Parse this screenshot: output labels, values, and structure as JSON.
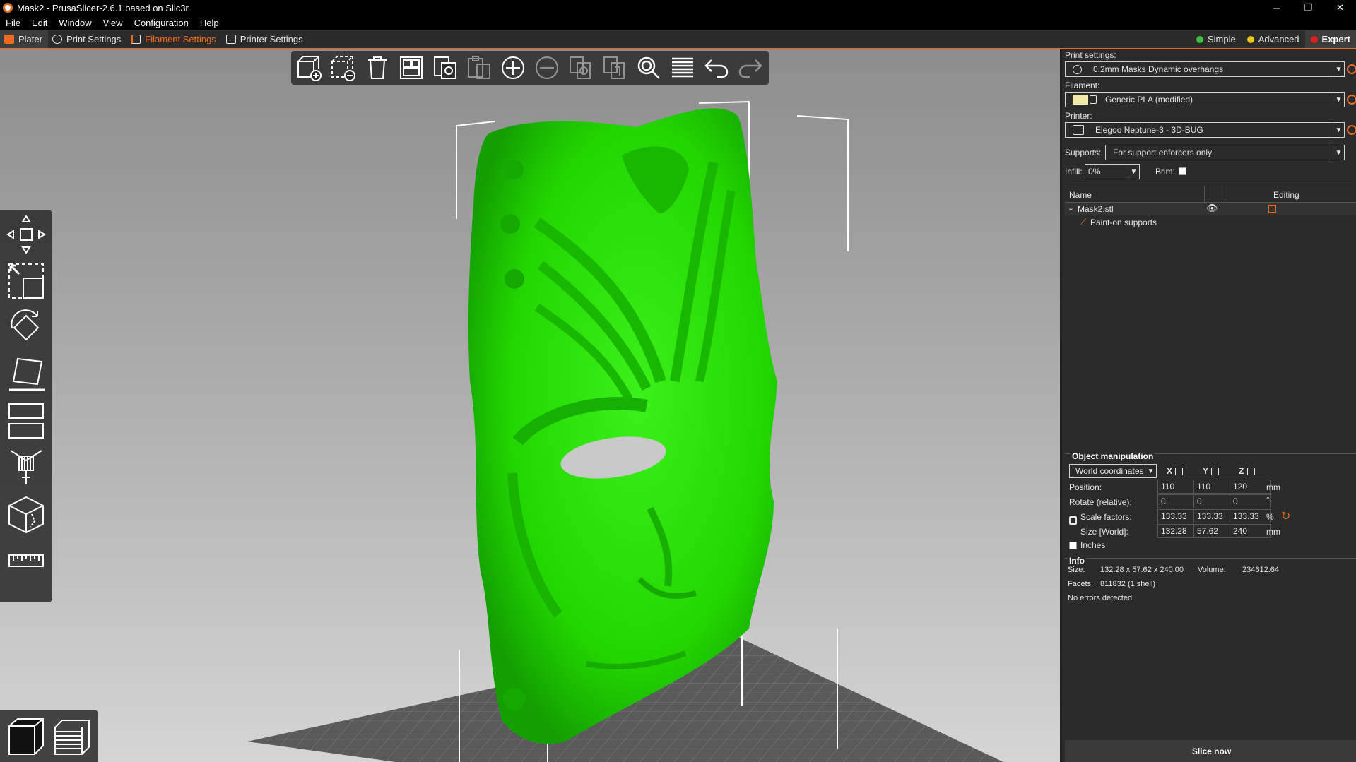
{
  "window": {
    "title": "Mask2 - PrusaSlicer-2.6.1 based on Slic3r",
    "controls": [
      "─",
      "❐",
      "✕"
    ]
  },
  "menu": [
    "File",
    "Edit",
    "Window",
    "View",
    "Configuration",
    "Help"
  ],
  "tabs": [
    {
      "label": "Plater",
      "icon": "plater-icon"
    },
    {
      "label": "Print Settings",
      "icon": "print-settings-icon"
    },
    {
      "label": "Filament Settings",
      "icon": "filament-icon"
    },
    {
      "label": "Printer Settings",
      "icon": "printer-icon"
    }
  ],
  "modes": [
    {
      "label": "Simple",
      "color": "#3ec13e"
    },
    {
      "label": "Advanced",
      "color": "#e8c51a"
    },
    {
      "label": "Expert",
      "color": "#e02020"
    }
  ],
  "toolbar_icons": [
    "add-icon",
    "delete-icon",
    "delete-all-icon",
    "arrange-icon",
    "copy-icon",
    "paste-icon",
    "add-instance-icon",
    "remove-instance-icon",
    "split-objects-icon",
    "split-parts-icon",
    "search-icon",
    "layers-editing-icon",
    "undo-icon",
    "redo-icon"
  ],
  "left_tools": [
    "move-icon",
    "scale-icon",
    "rotate-icon",
    "place-on-face-icon",
    "cut-icon",
    "support-paint-icon",
    "seam-paint-icon",
    "measure-icon"
  ],
  "view_toggle": [
    "3d-view-icon",
    "preview-icon"
  ],
  "sidebar": {
    "print_settings_label": "Print settings:",
    "print_settings_value": "0.2mm Masks Dynamic overhangs",
    "filament_label": "Filament:",
    "filament_value": "Generic PLA (modified)",
    "filament_color": "#f0e9a8",
    "printer_label": "Printer:",
    "printer_value": "Elegoo Neptune-3 - 3D-BUG",
    "supports_label": "Supports:",
    "supports_value": "For support enforcers only",
    "infill_label": "Infill:",
    "infill_value": "0%",
    "brim_label": "Brim:",
    "object_list": {
      "col_name": "Name",
      "col_editing": "Editing",
      "object_name": "Mask2.stl",
      "sub_item": "Paint-on supports"
    },
    "manipulation": {
      "title": "Object manipulation",
      "coord_system": "World coordinates",
      "axes": [
        "X",
        "Y",
        "Z"
      ],
      "rows": [
        {
          "label": "Position:",
          "values": [
            "110",
            "110",
            "120"
          ],
          "unit": "mm"
        },
        {
          "label": "Rotate (relative):",
          "values": [
            "0",
            "0",
            "0"
          ],
          "unit": "°"
        },
        {
          "label": "Scale factors:",
          "values": [
            "133.33",
            "133.33",
            "133.33"
          ],
          "unit": "%"
        },
        {
          "label": "Size [World]:",
          "values": [
            "132.28",
            "57.62",
            "240"
          ],
          "unit": "mm"
        }
      ],
      "inches_label": "Inches"
    },
    "info": {
      "title": "Info",
      "size_label": "Size:",
      "size_value": "132.28 x 57.62 x 240.00",
      "volume_label": "Volume:",
      "volume_value": "234612.64",
      "facets_label": "Facets:",
      "facets_value": "811832 (1 shell)",
      "status": "No errors detected"
    },
    "slice_button": "Slice now"
  },
  "colors": {
    "accent": "#ed6b21",
    "model": "#22dd00",
    "background": "#2b2b2b"
  }
}
